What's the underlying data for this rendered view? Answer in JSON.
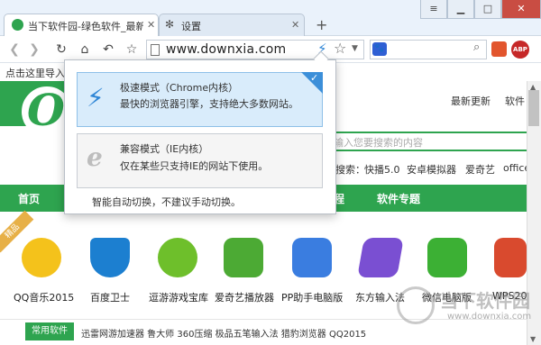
{
  "tabs": [
    {
      "label": "当下软件园-绿色软件_最新",
      "active": true
    },
    {
      "label": "设置",
      "active": false
    }
  ],
  "window_controls": {
    "minimize": "▁",
    "maximize": "□",
    "close": "✕",
    "menu": "≡"
  },
  "toolbar": {
    "url": "www.downxia.com",
    "search_placeholder": ""
  },
  "bookmarks_bar": {
    "text": "点击这里导入"
  },
  "popup": {
    "speed_mode": {
      "title": "极速模式（Chrome内核）",
      "desc": "最快的浏览器引擎，支持绝大多数网站。",
      "selected": true
    },
    "compat_mode": {
      "title": "兼容模式（IE内核）",
      "desc": "仅在某些只支持IE的网站下使用。"
    },
    "hint": "智能自动切换，不建议手动切换。"
  },
  "site": {
    "header_links": [
      "最新更新",
      "软件"
    ],
    "search_placeholder": "输入您要搜索的内容",
    "hot_prefix": "搜索：",
    "hot_items": [
      "快播5.0",
      "安卓模拟器",
      "爱奇艺",
      "office"
    ],
    "nav_items": [
      "首页",
      "程",
      "软件专题"
    ],
    "ribbon": "精品",
    "apps": [
      {
        "label": "QQ音乐2015",
        "color": "#f4c21b"
      },
      {
        "label": "百度卫士",
        "color": "#1c7fd0"
      },
      {
        "label": "逗游游戏宝库",
        "color": "#6ebf2b"
      },
      {
        "label": "爱奇艺播放器",
        "color": "#4caa34"
      },
      {
        "label": "PP助手电脑版",
        "color": "#3a7de0"
      },
      {
        "label": "东方输入法",
        "color": "#7a4fd2"
      },
      {
        "label": "微信电脑版",
        "color": "#3cb034"
      },
      {
        "label": "WPS20",
        "color": "#d94a2e"
      }
    ],
    "bottom_tab": "常用软件",
    "bottom_items": "迅雷网游加速器  鲁大师  360压缩  极品五笔输入法  猎豹浏览器  QQ2015"
  },
  "watermark": {
    "text": "当下软件园",
    "url": "www.downxia.com"
  },
  "colors": {
    "brand_green": "#2ea44f",
    "selected_blue": "#3c8fd9"
  }
}
